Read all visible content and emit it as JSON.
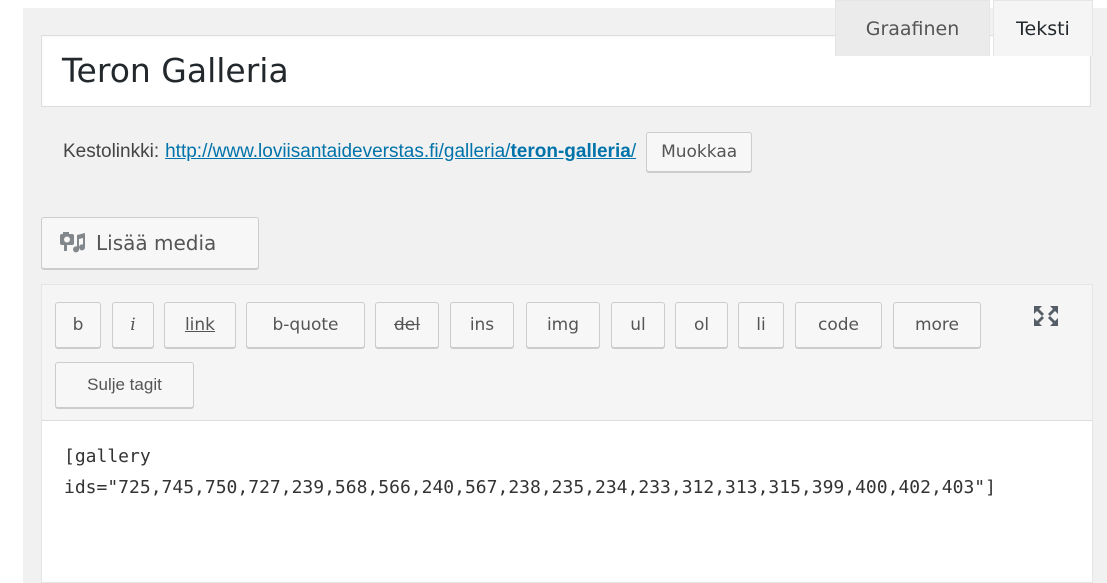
{
  "post": {
    "title": "Teron Galleria"
  },
  "permalink": {
    "label": "Kestolinkki:",
    "base_url": "http://www.loviisantaideverstas.fi/galleria/",
    "slug": "teron-galleria",
    "trailing": "/",
    "edit_button": "Muokkaa"
  },
  "media": {
    "add_media_label": "Lisää media",
    "icon": "media-icon"
  },
  "editor_tabs": {
    "visual": "Graafinen",
    "text": "Teksti",
    "active": "text"
  },
  "quicktags": {
    "buttons": [
      "b",
      "i",
      "link",
      "b-quote",
      "del",
      "ins",
      "img",
      "ul",
      "ol",
      "li",
      "code",
      "more"
    ],
    "close_tags": "Sulje tagit",
    "fullscreen_icon": "fullscreen-icon"
  },
  "content": {
    "text": "[gallery\nids=\"725,745,750,727,239,568,566,240,567,238,235,234,233,312,313,315,399,400,402,403\"]"
  }
}
